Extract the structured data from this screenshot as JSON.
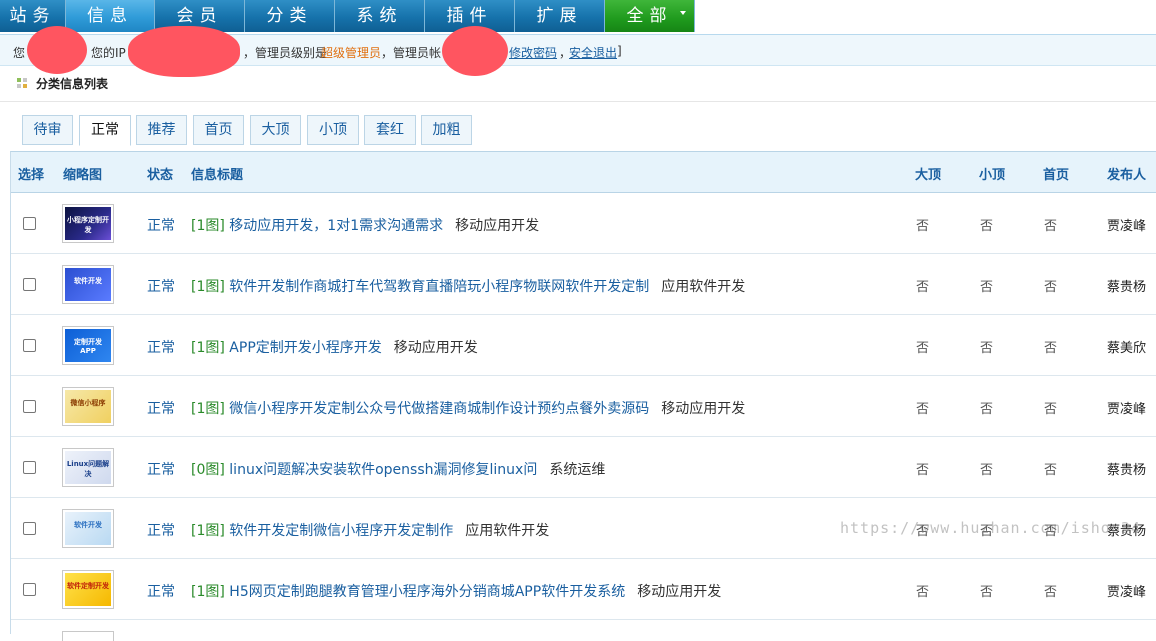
{
  "nav": {
    "items": [
      "站务",
      "信息",
      "会员",
      "分类",
      "系统",
      "插件",
      "扩展",
      "全部"
    ]
  },
  "infobar": {
    "prefix": "您",
    "ip_label": "您的IP",
    "level_text": "，管理员级别是",
    "role": "超级管理员",
    "account_text": "，管理员帐",
    "change_password": "修改密码",
    "sep": "，",
    "logout": "安全退出",
    "close": "]"
  },
  "page": {
    "title": "分类信息列表"
  },
  "tabs": [
    "待审",
    "正常",
    "推荐",
    "首页",
    "大顶",
    "小顶",
    "套红",
    "加粗"
  ],
  "table": {
    "headers": [
      "选择",
      "缩略图",
      "状态",
      "信息标题",
      "大顶",
      "小顶",
      "首页",
      "发布人"
    ],
    "rows": [
      {
        "status": "正常",
        "pic": "[1图]",
        "title": "移动应用开发，1对1需求沟通需求",
        "category": "移动应用开发",
        "top_big": "否",
        "top_small": "否",
        "home": "否",
        "publisher": "贾凌峰",
        "thumb_text": "小程序定制开发"
      },
      {
        "status": "正常",
        "pic": "[1图]",
        "title": "软件开发制作商城打车代驾教育直播陪玩小程序物联网软件开发定制",
        "category": "应用软件开发",
        "top_big": "否",
        "top_small": "否",
        "home": "否",
        "publisher": "蔡贵杨",
        "thumb_text": "软件开发"
      },
      {
        "status": "正常",
        "pic": "[1图]",
        "title": "APP定制开发小程序开发",
        "category": "移动应用开发",
        "top_big": "否",
        "top_small": "否",
        "home": "否",
        "publisher": "蔡美欣",
        "thumb_text": "定制开发 APP"
      },
      {
        "status": "正常",
        "pic": "[1图]",
        "title": "微信小程序开发定制公众号代做搭建商城制作设计预约点餐外卖源码",
        "category": "移动应用开发",
        "top_big": "否",
        "top_small": "否",
        "home": "否",
        "publisher": "贾凌峰",
        "thumb_text": "微信小程序"
      },
      {
        "status": "正常",
        "pic": "[0图]",
        "title": "linux问题解决安装软件openssh漏洞修复linux问",
        "category": "系统运维",
        "top_big": "否",
        "top_small": "否",
        "home": "否",
        "publisher": "蔡贵杨",
        "thumb_text": "Linux问题解决"
      },
      {
        "status": "正常",
        "pic": "[1图]",
        "title": "软件开发定制微信小程序开发定制作",
        "category": "应用软件开发",
        "top_big": "否",
        "top_small": "否",
        "home": "否",
        "publisher": "蔡贵杨",
        "thumb_text": "软件开发"
      },
      {
        "status": "正常",
        "pic": "[1图]",
        "title": "H5网页定制跑腿教育管理小程序海外分销商城APP软件开发系统",
        "category": "移动应用开发",
        "top_big": "否",
        "top_small": "否",
        "home": "否",
        "publisher": "贾凌峰",
        "thumb_text": "软件定制开发"
      }
    ]
  },
  "watermark": "https://www.huzhan.com/ishop34",
  "colors": {
    "nav_blue": "#1672ab",
    "nav_active": "#2f9bd8",
    "nav_green": "#1f9a1d",
    "link": "#1a5fa0",
    "role": "#e07010",
    "redaction": "#ff5560"
  }
}
